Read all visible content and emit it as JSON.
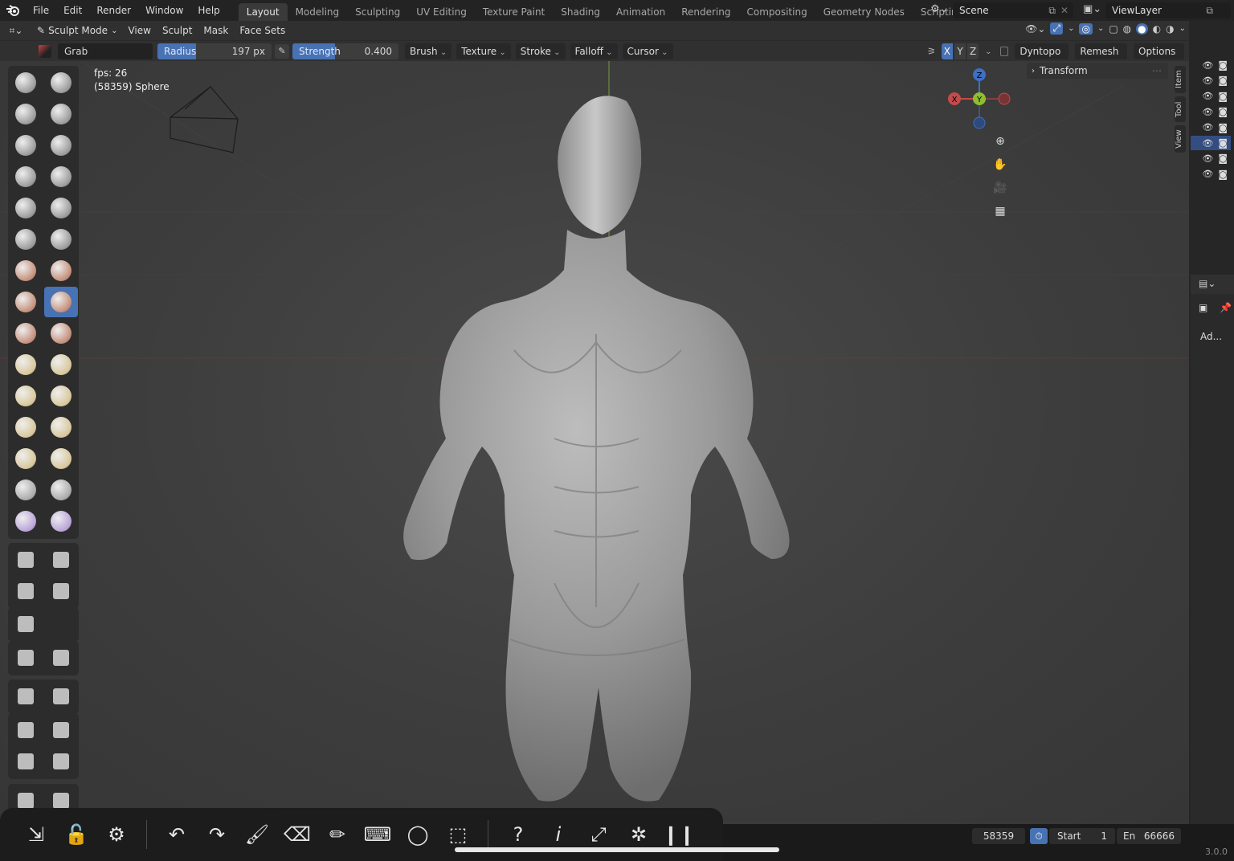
{
  "menus": [
    "File",
    "Edit",
    "Render",
    "Window",
    "Help"
  ],
  "workspaces": [
    "Layout",
    "Modeling",
    "Sculpting",
    "UV Editing",
    "Texture Paint",
    "Shading",
    "Animation",
    "Rendering",
    "Compositing",
    "Geometry Nodes",
    "Scripting"
  ],
  "active_workspace": "Layout",
  "scene": "Scene",
  "view_layer": "ViewLayer",
  "header": {
    "mode": "Sculpt Mode",
    "items": [
      "View",
      "Sculpt",
      "Mask",
      "Face Sets"
    ]
  },
  "tool_settings": {
    "brush_name": "Grab",
    "radius_label": "Radius",
    "radius_value": "197 px",
    "strength_label": "Strength",
    "strength_value": "0.400",
    "strength_fraction": 0.4,
    "dropdowns": [
      "Brush",
      "Texture",
      "Stroke",
      "Falloff",
      "Cursor"
    ],
    "axes": [
      "X",
      "Y",
      "Z"
    ],
    "right_dropdowns": [
      "Dyntopo",
      "Remesh",
      "Options"
    ]
  },
  "viewport": {
    "fps": "fps: 26",
    "object_info": "(58359) Sphere"
  },
  "sidebar": {
    "panel": "Transform",
    "tabs": [
      "Item",
      "Tool",
      "View"
    ]
  },
  "properties": {
    "dropdown": "Ad..."
  },
  "status": {
    "vertices": "58359",
    "start_label": "Start",
    "start_value": "1",
    "end_label": "En",
    "end_value": "66666",
    "version": "3.0.0"
  },
  "gizmo": {
    "x": "X",
    "y": "Y",
    "z": "Z"
  },
  "ios_toolbar_icons": [
    "arrow-in-icon",
    "unlock-icon",
    "gear-icon",
    "undo-icon",
    "redo-icon",
    "brush-icon",
    "eraser-icon",
    "pen-icon",
    "keyboard-icon",
    "lasso-icon",
    "box-select-icon",
    "help-icon",
    "info-icon",
    "fullscreen-icon",
    "settings-icon",
    "pause-icon"
  ],
  "ios_glyphs": {
    "help": "?",
    "info": "i"
  },
  "colors": {
    "accent": "#4772b3",
    "axis_x": "#c44b4b",
    "axis_y": "#8fbc32",
    "axis_z": "#3e6fc4"
  }
}
